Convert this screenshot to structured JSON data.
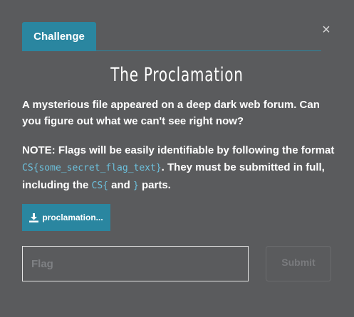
{
  "modal": {
    "close_glyph": "×",
    "tab_label": "Challenge",
    "title": "The Proclamation",
    "description": "A mysterious file appeared on a deep dark web forum. Can you figure out what we can't see right now?",
    "note": {
      "prefix": "NOTE: Flags will be easily identifiable by following the format ",
      "format_code": "CS{some_secret_flag_text}",
      "middle": ". They must be submitted in full, including the ",
      "open_code": "CS{",
      "and_text": " and ",
      "close_code": "}",
      "suffix": " parts."
    },
    "download_label": "proclamation...",
    "flag_placeholder": "Flag",
    "submit_label": "Submit"
  },
  "colors": {
    "accent": "#2a86a0",
    "background": "#5a5b5d",
    "code": "#6cc1dd"
  }
}
